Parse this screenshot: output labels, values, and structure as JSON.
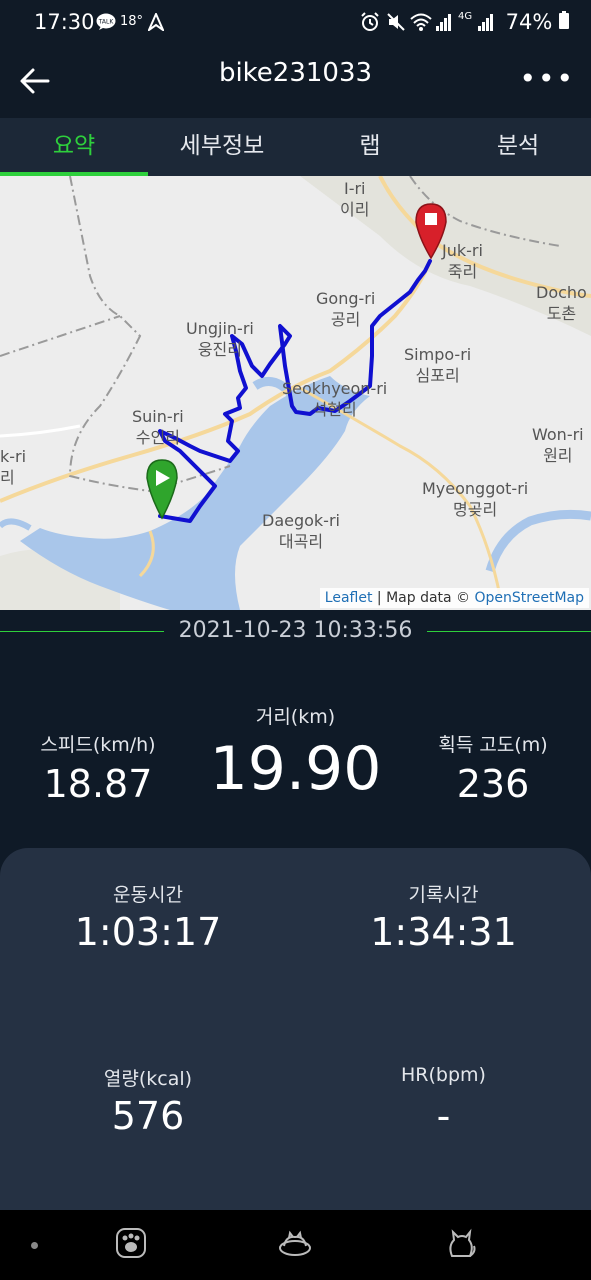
{
  "status_bar": {
    "time": "17:30",
    "temperature": "18°",
    "battery": "74%",
    "network": "4G"
  },
  "header": {
    "title": "bike231033",
    "back_icon": "arrow-left-icon",
    "menu_icon": "more-vertical-icon"
  },
  "tabs": [
    {
      "label": "요약",
      "active": true
    },
    {
      "label": "세부정보",
      "active": false
    },
    {
      "label": "랩",
      "active": false
    },
    {
      "label": "분석",
      "active": false
    }
  ],
  "map": {
    "labels": [
      {
        "roman": "I-ri",
        "korean": "이리"
      },
      {
        "roman": "Juk-ri",
        "korean": "죽리"
      },
      {
        "roman": "Docho",
        "korean": "도촌"
      },
      {
        "roman": "Gong-ri",
        "korean": "공리"
      },
      {
        "roman": "Ungjin-ri",
        "korean": "웅진리"
      },
      {
        "roman": "Simpo-ri",
        "korean": "심포리"
      },
      {
        "roman": "Seokhyeon-ri",
        "korean": "석현리"
      },
      {
        "roman": "Suin-ri",
        "korean": "수인리"
      },
      {
        "roman": "k-ri",
        "korean": "리"
      },
      {
        "roman": "Won-ri",
        "korean": "원리"
      },
      {
        "roman": "Myeonggot-ri",
        "korean": "명곶리"
      },
      {
        "roman": "Daegok-ri",
        "korean": "대곡리"
      }
    ],
    "attribution": {
      "leaflet": "Leaflet",
      "sep": "|",
      "text": "Map data ©",
      "osm": "OpenStreetMap"
    },
    "route_color": "#1010d0",
    "start_marker_color": "#2fa52c",
    "end_marker_color": "#d7202a"
  },
  "date": "2021-10-23 10:33:56",
  "stats": {
    "speed": {
      "label": "스피드(km/h)",
      "value": "18.87"
    },
    "distance": {
      "label": "거리(km)",
      "value": "19.90"
    },
    "elevation": {
      "label": "획득 고도(m)",
      "value": "236"
    },
    "moving_time": {
      "label": "운동시간",
      "value": "1:03:17"
    },
    "elapsed_time": {
      "label": "기록시간",
      "value": "1:34:31"
    },
    "calories": {
      "label": "열량(kcal)",
      "value": "576"
    },
    "heart_rate": {
      "label": "HR(bpm)",
      "value": "-"
    }
  },
  "bottom_nav": [
    "paw-icon",
    "cat-bed-icon",
    "cat-icon"
  ],
  "colors": {
    "accent": "#2ed03c",
    "background": "#0f1a27",
    "card": "#253143",
    "tab_bar": "#1c2837"
  }
}
